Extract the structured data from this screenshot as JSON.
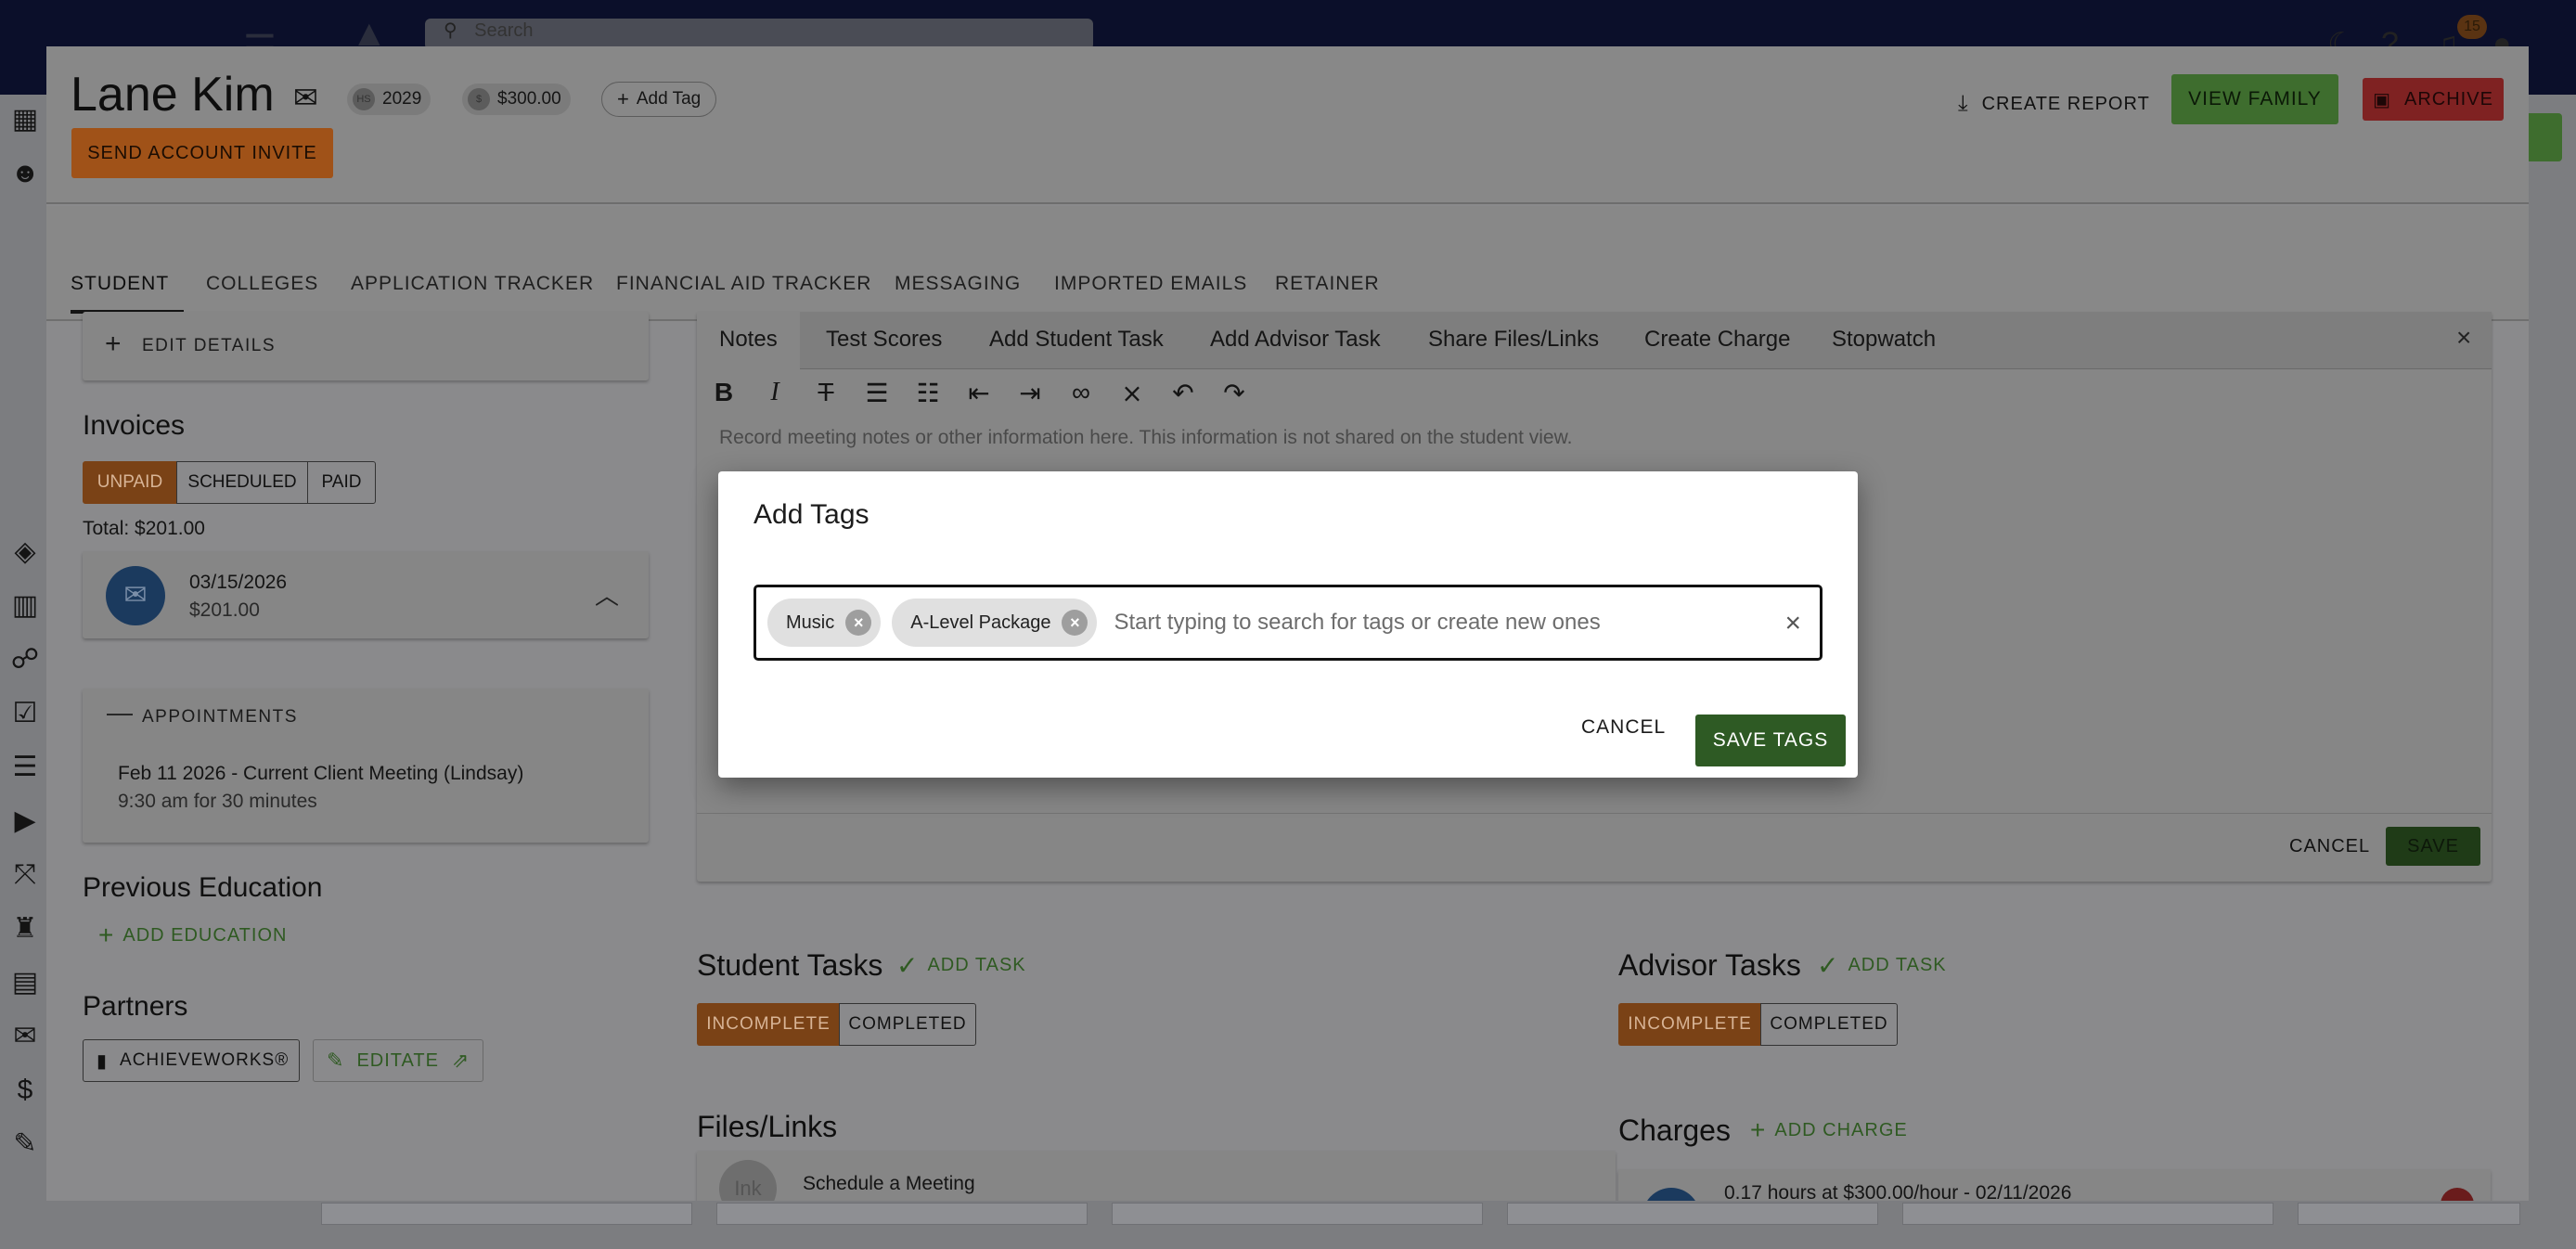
{
  "topbar": {
    "search_placeholder": "Search",
    "notification_count": "15"
  },
  "student": {
    "name": "Lane Kim",
    "grad_year_prefix": "HS",
    "grad_year": "2029",
    "balance_prefix": "$",
    "balance": "$300.00",
    "add_tag_label": "Add Tag",
    "send_invite_label": "SEND ACCOUNT INVITE"
  },
  "header_actions": {
    "create_report": "CREATE REPORT",
    "view_family": "VIEW FAMILY",
    "archive": "ARCHIVE"
  },
  "tabs": [
    "STUDENT",
    "COLLEGES",
    "APPLICATION TRACKER",
    "FINANCIAL AID TRACKER",
    "MESSAGING",
    "IMPORTED EMAILS",
    "RETAINER"
  ],
  "left": {
    "edit_details": "EDIT DETAILS",
    "invoices_title": "Invoices",
    "invoice_filters": [
      "UNPAID",
      "SCHEDULED",
      "PAID"
    ],
    "total": "Total: $201.00",
    "invoice": {
      "date": "03/15/2026",
      "amount": "$201.00"
    },
    "appointments_title": "APPOINTMENTS",
    "appointment": {
      "title": "Feb 11 2026 - Current Client Meeting (Lindsay)",
      "time": "9:30 am for 30 minutes"
    },
    "previous_education": "Previous Education",
    "add_education": "ADD EDUCATION",
    "partners": "Partners",
    "partner_1": "ACHIEVEWORKS®",
    "partner_2": "EDITATE"
  },
  "editor": {
    "tabs": [
      "Notes",
      "Test Scores",
      "Add Student Task",
      "Add Advisor Task",
      "Share Files/Links",
      "Create Charge",
      "Stopwatch"
    ],
    "placeholder": "Record meeting notes or other information here. This information is not shared on the student view.",
    "cancel": "CANCEL",
    "save": "SAVE"
  },
  "student_tasks": {
    "title": "Student Tasks",
    "add": "ADD TASK",
    "filters": [
      "INCOMPLETE",
      "COMPLETED"
    ]
  },
  "advisor_tasks": {
    "title": "Advisor Tasks",
    "add": "ADD TASK",
    "filters": [
      "INCOMPLETE",
      "COMPLETED"
    ]
  },
  "files": {
    "title": "Files/Links",
    "item_avatar": "Ink",
    "item_label": "Schedule a Meeting"
  },
  "charges": {
    "title": "Charges",
    "add": "ADD CHARGE",
    "item_label": "0.17 hours at $300.00/hour - 02/11/2026"
  },
  "modal": {
    "title": "Add Tags",
    "tags": [
      "Music",
      "A-Level Package"
    ],
    "input_placeholder": "Start typing to search for tags or create new ones",
    "cancel": "CANCEL",
    "save": "SAVE TAGS"
  },
  "colors": {
    "accent_orange": "#a05218",
    "primary_green": "#2e5a24",
    "archive_red": "#7f2222",
    "topbar_navy": "#0b0f2a"
  }
}
